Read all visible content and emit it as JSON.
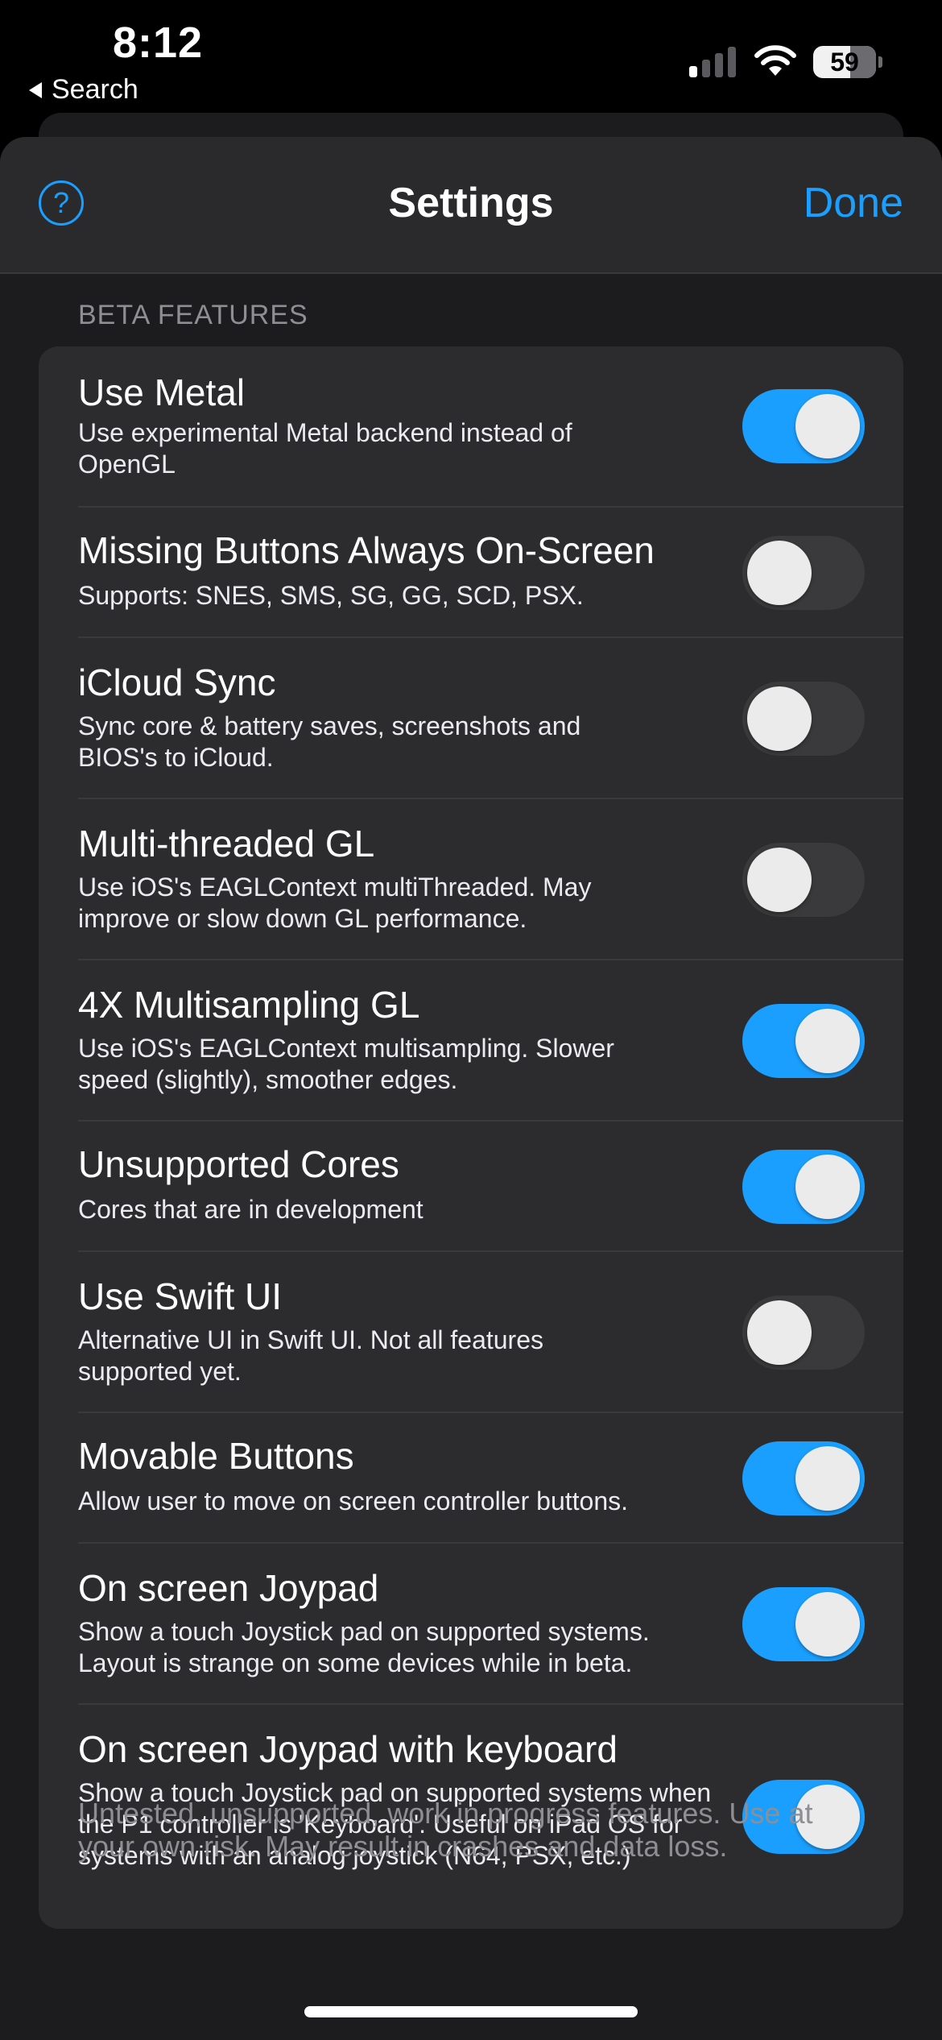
{
  "status_bar": {
    "time": "8:12",
    "back_label": "Search",
    "battery_percent": "59",
    "signal_bars_active": 1,
    "signal_bars_total": 4
  },
  "nav": {
    "help_label": "?",
    "title": "Settings",
    "done_label": "Done"
  },
  "section": {
    "header": "BETA FEATURES",
    "footer": "Untested, unsupported, work in progress features. Use at your own risk. May result in crashes and data loss."
  },
  "settings": [
    {
      "title": "Use Metal",
      "subtitle": "Use experimental Metal backend instead of OpenGL",
      "enabled": true
    },
    {
      "title": "Missing Buttons Always On-Screen",
      "subtitle": "Supports: SNES, SMS, SG, GG, SCD, PSX.",
      "enabled": false
    },
    {
      "title": "iCloud Sync",
      "subtitle": "Sync core & battery saves, screenshots and BIOS's to iCloud.",
      "enabled": false
    },
    {
      "title": "Multi-threaded GL",
      "subtitle": "Use iOS's EAGLContext multiThreaded. May improve or slow down GL performance.",
      "enabled": false
    },
    {
      "title": "4X Multisampling GL",
      "subtitle": "Use iOS's EAGLContext multisampling. Slower speed (slightly), smoother edges.",
      "enabled": true
    },
    {
      "title": "Unsupported Cores",
      "subtitle": "Cores that are in development",
      "enabled": true
    },
    {
      "title": "Use Swift UI",
      "subtitle": "Alternative UI in Swift UI. Not all features supported yet.",
      "enabled": false
    },
    {
      "title": "Movable Buttons",
      "subtitle": "Allow user to move on screen controller buttons.",
      "enabled": true
    },
    {
      "title": "On screen Joypad",
      "subtitle": "Show a touch Joystick pad on supported systems. Layout is strange on some devices while in beta.",
      "enabled": true
    },
    {
      "title": "On screen Joypad with keyboard",
      "subtitle": "Show a touch Joystick pad on supported systems when the P1 controller is 'Keyboard'. Useful on iPad OS for systems with an analog joystick (N64, PSX, etc.)",
      "enabled": true
    }
  ],
  "colors": {
    "accent": "#1a9fff",
    "sheet_background": "#1c1c1e",
    "cell_background": "#2c2c2e",
    "toggle_off": "#3a3a3c",
    "secondary_text": "#8e8e93"
  },
  "icons": {
    "back": "back-triangle-icon",
    "signal": "cellular-signal-icon",
    "wifi": "wifi-icon",
    "battery": "battery-icon",
    "help": "question-circle-icon"
  }
}
